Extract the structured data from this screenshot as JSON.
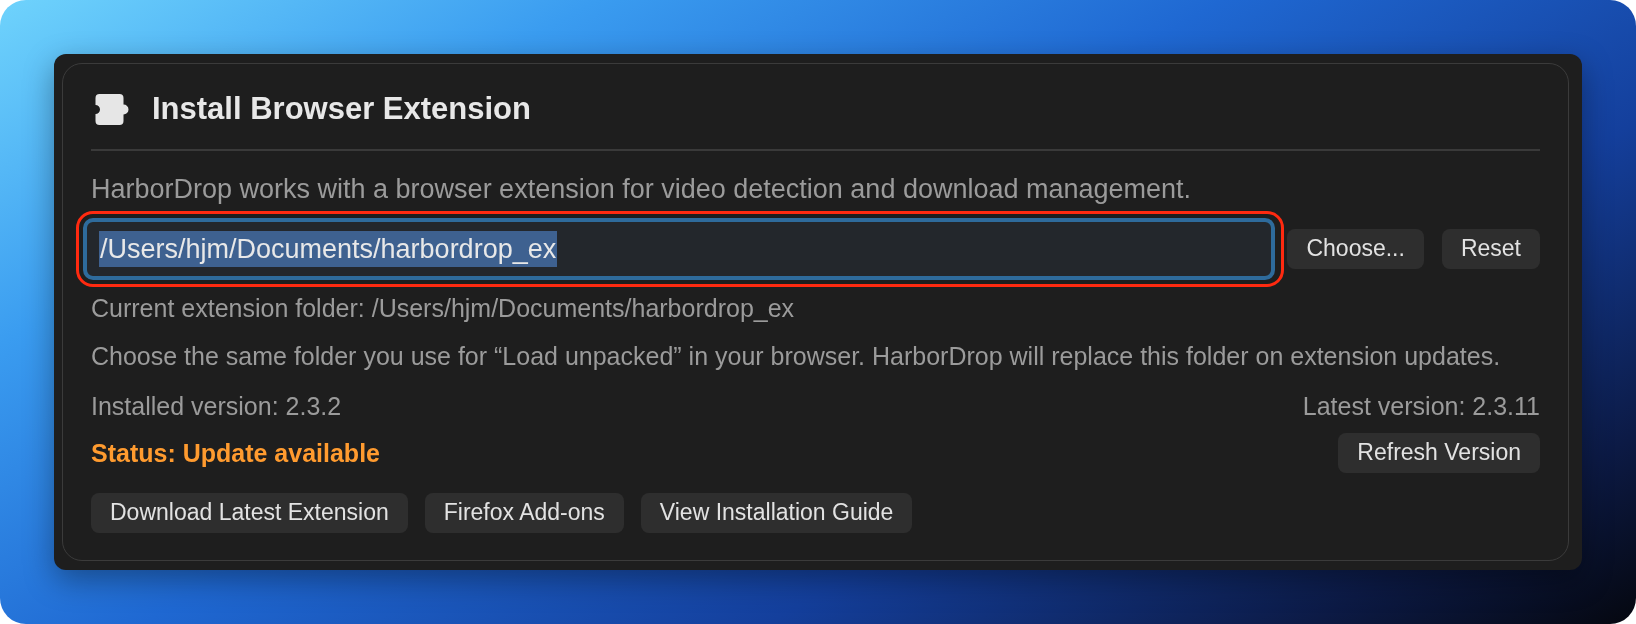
{
  "window": {
    "title": "Install Browser Extension"
  },
  "description": "HarborDrop works with a browser extension for video detection and download management.",
  "folder_field": {
    "value": "/Users/hjm/Documents/harbordrop_ex",
    "focused": true,
    "text_selected": true,
    "highlighted": true
  },
  "field_buttons": [
    "Choose...",
    "Reset"
  ],
  "current_folder": "Current extension folder: /Users/hjm/Documents/harbordrop_ex",
  "hint": "Choose the same folder you use for “Load unpacked” in your browser. HarborDrop will replace this folder on extension updates.",
  "installed_version": "Installed version: 2.3.2",
  "latest_version": "Latest version: 2.3.11",
  "status": {
    "text": "Status: Update available",
    "kind": "warning"
  },
  "refresh_button": "Refresh Version",
  "action_buttons": [
    "Download Latest Extension",
    "Firefox Add-ons",
    "View Installation Guide"
  ]
}
